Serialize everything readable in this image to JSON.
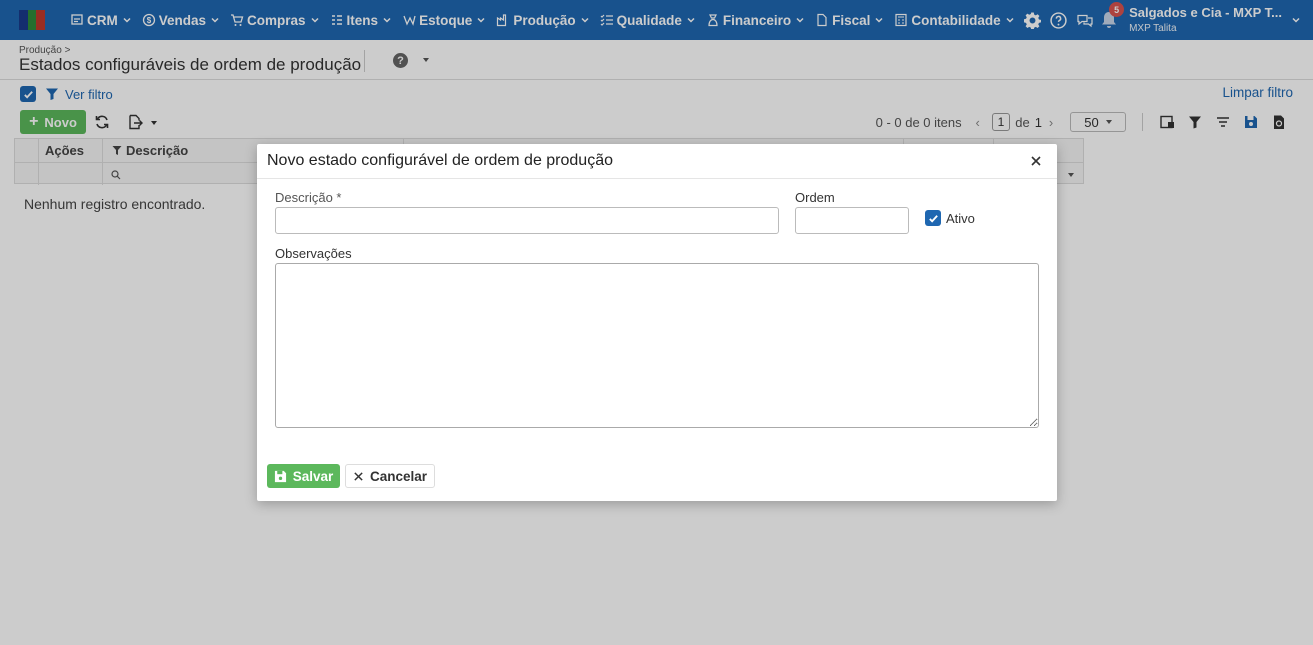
{
  "nav": {
    "menu": [
      {
        "label": "CRM",
        "icon": "crm-icon"
      },
      {
        "label": "Vendas",
        "icon": "money-icon"
      },
      {
        "label": "Compras",
        "icon": "cart-icon"
      },
      {
        "label": "Itens",
        "icon": "items-icon"
      },
      {
        "label": "Estoque",
        "icon": "stock-icon"
      },
      {
        "label": "Produção",
        "icon": "factory-icon"
      },
      {
        "label": "Qualidade",
        "icon": "checklist-icon"
      },
      {
        "label": "Financeiro",
        "icon": "finance-icon"
      },
      {
        "label": "Fiscal",
        "icon": "document-icon"
      },
      {
        "label": "Contabilidade",
        "icon": "calculator-icon"
      }
    ],
    "notifications_count": "5",
    "company": "Salgados e Cia - MXP T...",
    "user": "MXP Talita"
  },
  "header": {
    "breadcrumb": "Produção >",
    "title": "Estados configuráveis de ordem de produção"
  },
  "filter": {
    "label": "Ver filtro",
    "clear_label": "Limpar filtro"
  },
  "toolbar": {
    "new_label": "Novo"
  },
  "pager": {
    "summary": "0 - 0 de 0 itens",
    "page": "1",
    "of_label": "de",
    "total_pages": "1",
    "page_size": "50"
  },
  "grid": {
    "columns": [
      "Ações",
      "Descrição"
    ],
    "empty_message": "Nenhum registro encontrado."
  },
  "modal": {
    "title": "Novo estado configurável de ordem de produção",
    "descricao_label": "Descrição *",
    "descricao_value": "",
    "ordem_label": "Ordem",
    "ordem_value": "",
    "ativo_label": "Ativo",
    "ativo_checked": true,
    "observacoes_label": "Observações",
    "observacoes_value": "",
    "save_label": "Salvar",
    "cancel_label": "Cancelar"
  },
  "colors": {
    "nav_bg": "#1f67b1",
    "primary": "#1f67b1",
    "success": "#5cb85c",
    "badge": "#d9534f"
  }
}
